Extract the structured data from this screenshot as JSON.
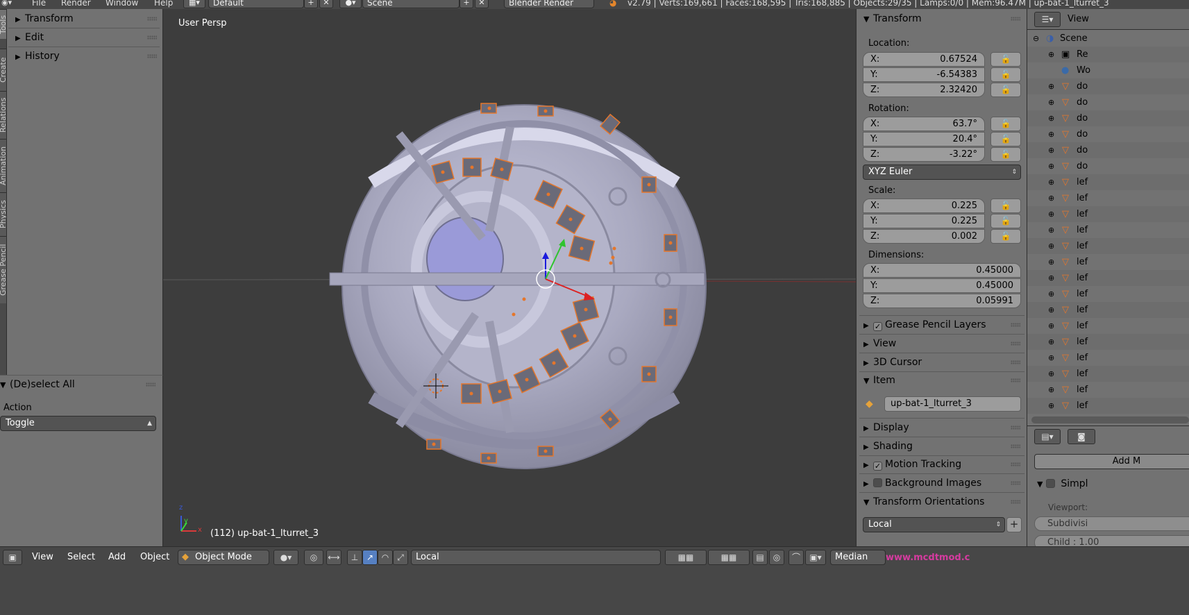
{
  "top_menu": {
    "file": "File",
    "render": "Render",
    "window": "Window",
    "help": "Help",
    "screen_layout": "Default",
    "scene": "Scene",
    "engine": "Blender Render",
    "stats": "v2.79 | Verts:169,661 | Faces:168,595 | Tris:168,885 | Objects:29/35 | Lamps:0/0 | Mem:96.47M | up-bat-1_lturret_3"
  },
  "tool_tabs": [
    "Tools",
    "Create",
    "Relations",
    "Animation",
    "Physics",
    "Grease Pencil"
  ],
  "tool_shelf": {
    "panels": [
      "Transform",
      "Edit",
      "History"
    ]
  },
  "last_operator": {
    "title": "(De)select All",
    "action_label": "Action",
    "action_value": "Toggle"
  },
  "viewport": {
    "view_name": "User Persp",
    "object_label": "(112) up-bat-1_lturret_3",
    "axis_z": "z",
    "axis_y": "y",
    "axis_x": "x"
  },
  "properties": {
    "transform_title": "Transform",
    "location_label": "Location:",
    "location": [
      {
        "axis": "X:",
        "value": "0.67524"
      },
      {
        "axis": "Y:",
        "value": "-6.54383"
      },
      {
        "axis": "Z:",
        "value": "2.32420"
      }
    ],
    "rotation_label": "Rotation:",
    "rotation": [
      {
        "axis": "X:",
        "value": "63.7°"
      },
      {
        "axis": "Y:",
        "value": "20.4°"
      },
      {
        "axis": "Z:",
        "value": "-3.22°"
      }
    ],
    "rotation_mode": "XYZ Euler",
    "scale_label": "Scale:",
    "scale": [
      {
        "axis": "X:",
        "value": "0.225"
      },
      {
        "axis": "Y:",
        "value": "0.225"
      },
      {
        "axis": "Z:",
        "value": "0.002"
      }
    ],
    "dimensions_label": "Dimensions:",
    "dimensions": [
      {
        "axis": "X:",
        "value": "0.45000"
      },
      {
        "axis": "Y:",
        "value": "0.45000"
      },
      {
        "axis": "Z:",
        "value": "0.05991"
      }
    ],
    "grease_pencil_layers": "Grease Pencil Layers",
    "view": "View",
    "cursor": "3D Cursor",
    "item": "Item",
    "item_name": "up-bat-1_lturret_3",
    "display": "Display",
    "shading": "Shading",
    "motion_tracking": "Motion Tracking",
    "background_images": "Background Images",
    "transform_orientations": "Transform Orientations",
    "orientation_value": "Local"
  },
  "outliner": {
    "view_label": "View",
    "rows": [
      "Scene",
      "Re",
      "Wo",
      "do",
      "do",
      "do",
      "do",
      "do",
      "do",
      "lef",
      "lef",
      "lef",
      "lef",
      "lef",
      "lef",
      "lef",
      "lef",
      "lef",
      "lef",
      "lef",
      "lef",
      "lef",
      "lef",
      "lef",
      "lef"
    ]
  },
  "property_editor": {
    "add_modifier": "Add M",
    "simple_label": "Simpl",
    "viewport_label": "Viewport:",
    "subdiv_label": "Subdivisi",
    "child_label": "Child : 1.00"
  },
  "bottom_bar": {
    "view": "View",
    "select": "Select",
    "add": "Add",
    "object": "Object",
    "mode": "Object Mode",
    "orientation": "Local",
    "pivot": "Median"
  },
  "watermark": "www.mcdtmod.c",
  "colors": {
    "accent": "#5680c2",
    "selection_outline": "#e5762b",
    "panel_bg": "#727272",
    "viewport_bg": "#3d3d3d"
  }
}
